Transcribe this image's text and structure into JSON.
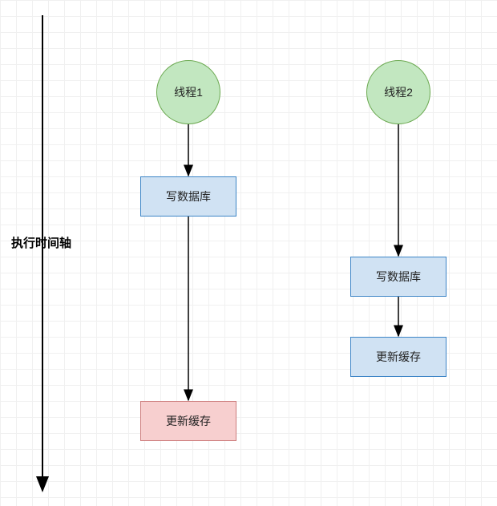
{
  "timeline_label": "执行时间轴",
  "thread1": {
    "label": "线程1",
    "step1": "写数据库",
    "step2": "更新缓存"
  },
  "thread2": {
    "label": "线程2",
    "step1": "写数据库",
    "step2": "更新缓存"
  },
  "colors": {
    "circle_fill": "#c2e7c0",
    "circle_stroke": "#6aa84f",
    "blue_fill": "#d0e2f3",
    "blue_stroke": "#3d85c6",
    "pink_fill": "#f7cfcf",
    "pink_stroke": "#cc7c7c",
    "arrow": "#000000"
  }
}
